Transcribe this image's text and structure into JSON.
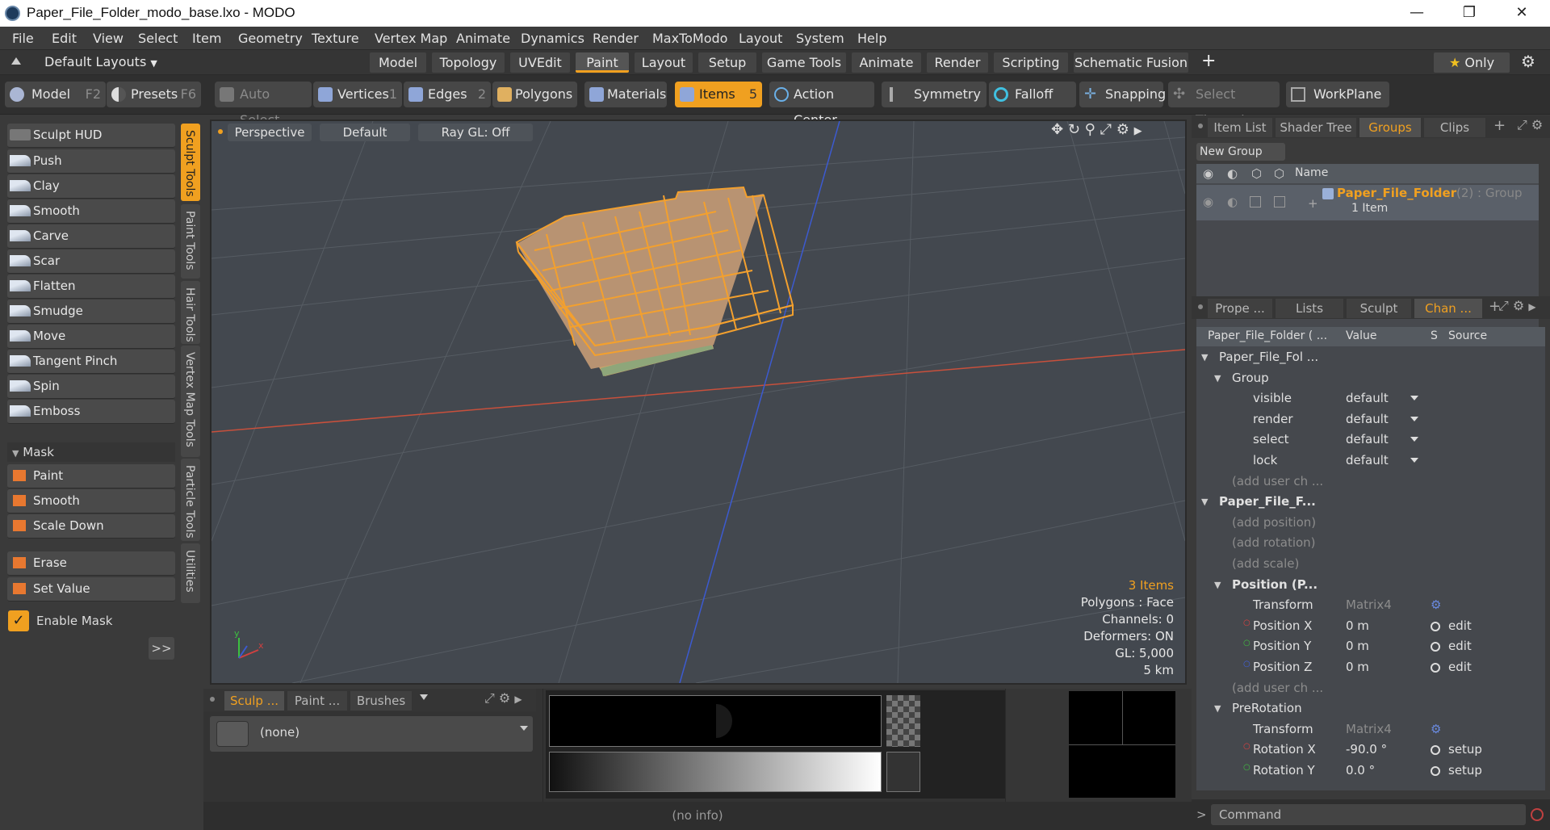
{
  "window": {
    "title": "Paper_File_Folder_modo_base.lxo - MODO",
    "minimize": "—",
    "maximize": "❐",
    "close": "✕"
  },
  "menu": [
    "File",
    "Edit",
    "View",
    "Select",
    "Item",
    "Geometry",
    "Texture",
    "Vertex Map",
    "Animate",
    "Dynamics",
    "Render",
    "MaxToModo",
    "Layout",
    "System",
    "Help"
  ],
  "layouts": {
    "label": "Default Layouts",
    "tabs": [
      "Model",
      "Topology",
      "UVEdit",
      "Paint",
      "Layout",
      "Setup",
      "Game Tools",
      "Animate",
      "Render",
      "Scripting",
      "Schematic Fusion"
    ],
    "active": "Paint",
    "add": "+",
    "only": "Only"
  },
  "toolbar": {
    "model": "Model",
    "model_key": "F2",
    "presets": "Presets",
    "presets_key": "F6",
    "auto_select": "Auto Select",
    "vertices": "Vertices",
    "vertices_key": "1",
    "edges": "Edges",
    "edges_key": "2",
    "polygons": "Polygons",
    "materials": "Materials",
    "items": "Items",
    "items_key": "5",
    "action_center": "Action Center",
    "symmetry": "Symmetry",
    "falloff": "Falloff",
    "snapping": "Snapping",
    "select_through": "Select Through",
    "workplane": "WorkPlane"
  },
  "sculpt": {
    "hud": "Sculpt HUD",
    "tools": [
      "Push",
      "Clay",
      "Smooth",
      "Carve",
      "Scar",
      "Flatten",
      "Smudge",
      "Move",
      "Tangent Pinch",
      "Spin",
      "Emboss"
    ],
    "mask_header": "Mask",
    "mask_tools": [
      "Paint",
      "Smooth",
      "Scale Down"
    ],
    "erase": "Erase",
    "set_value": "Set Value",
    "enable_mask": "Enable Mask",
    "more": ">>",
    "vtabs": [
      "Sculpt Tools",
      "Paint Tools",
      "Hair Tools",
      "Vertex Map Tools",
      "Particle Tools",
      "Utilities"
    ]
  },
  "viewport": {
    "perspective": "Perspective",
    "default": "Default",
    "raygl": "Ray GL: Off",
    "info": [
      "3 Items",
      "Polygons : Face",
      "Channels: 0",
      "Deformers: ON",
      "GL: 5,000",
      "5 km"
    ]
  },
  "groups": {
    "tabs": [
      "Item List",
      "Shader Tree",
      "Groups",
      "Clips"
    ],
    "active": "Groups",
    "add": "+",
    "new_group": "New Group",
    "name_col": "Name",
    "group_name": "Paper_File_Folder",
    "group_count": "(2) : Group",
    "group_items": "1 Item"
  },
  "channels": {
    "tabs": [
      "Prope ...",
      "Lists",
      "Sculpt",
      "Chan ..."
    ],
    "active": "Chan ...",
    "add": "+",
    "col_name": "Paper_File_Folder ( ...",
    "col_value": "Value",
    "col_s": "S",
    "col_source": "Source",
    "rows": [
      {
        "name": "Paper_File_Fol ...",
        "value": "",
        "source": "",
        "indent": 0
      },
      {
        "name": "Group",
        "value": "",
        "source": "",
        "indent": 1
      },
      {
        "name": "visible",
        "value": "default",
        "source": "",
        "indent": 2
      },
      {
        "name": "render",
        "value": "default",
        "source": "",
        "indent": 2
      },
      {
        "name": "select",
        "value": "default",
        "source": "",
        "indent": 2
      },
      {
        "name": "lock",
        "value": "default",
        "source": "",
        "indent": 2
      },
      {
        "name": "(add user ch ...",
        "value": "",
        "source": "",
        "indent": 1
      },
      {
        "name": "Paper_File_F...",
        "value": "",
        "source": "",
        "indent": 0
      },
      {
        "name": "(add position)",
        "value": "",
        "source": "",
        "indent": 1
      },
      {
        "name": "(add rotation)",
        "value": "",
        "source": "",
        "indent": 1
      },
      {
        "name": "(add scale)",
        "value": "",
        "source": "",
        "indent": 1
      },
      {
        "name": "Position (P...",
        "value": "",
        "source": "",
        "indent": 1
      },
      {
        "name": "Transform",
        "value": "Matrix4",
        "source": "",
        "indent": 2
      },
      {
        "name": "Position X",
        "value": "0 m",
        "source": "edit",
        "indent": 2
      },
      {
        "name": "Position Y",
        "value": "0 m",
        "source": "edit",
        "indent": 2
      },
      {
        "name": "Position Z",
        "value": "0 m",
        "source": "edit",
        "indent": 2
      },
      {
        "name": "(add user ch ...",
        "value": "",
        "source": "",
        "indent": 1
      },
      {
        "name": "PreRotation",
        "value": "",
        "source": "",
        "indent": 1
      },
      {
        "name": "Transform",
        "value": "Matrix4",
        "source": "",
        "indent": 2
      },
      {
        "name": "Rotation X",
        "value": "-90.0 °",
        "source": "setup",
        "indent": 2
      },
      {
        "name": "Rotation Y",
        "value": "0.0 °",
        "source": "setup",
        "indent": 2
      }
    ]
  },
  "bottom": {
    "tabs": [
      "Sculp ...",
      "Paint ...",
      "Brushes"
    ],
    "active": "Sculp ...",
    "none": "(none)",
    "no_info": "(no info)",
    "command": "Command",
    "prompt": ">"
  },
  "colors": {
    "accent": "#f0a020",
    "bg": "#3a3a3a",
    "viewport": "#43484f",
    "x_axis": "#c8503c",
    "y_axis": "#3c5ad0"
  }
}
